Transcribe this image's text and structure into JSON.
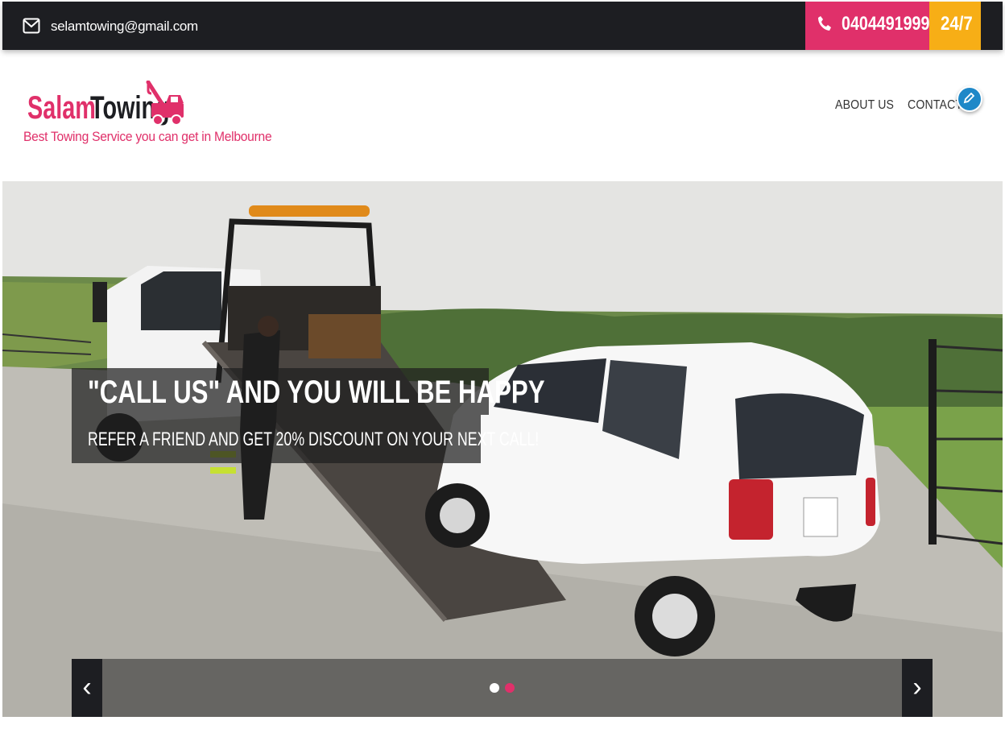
{
  "topbar": {
    "email": "selamtowing@gmail.com",
    "phone": "0404491999",
    "availability": "24/7"
  },
  "brand": {
    "name_part1": "Salam",
    "name_part2": "Towing",
    "tagline": "Best Towing Service you can get in Melbourne"
  },
  "nav": {
    "about": "ABOUT US",
    "contact": "CONTACT"
  },
  "slider": {
    "headline": "\"CALL US\" AND YOU WILL BE HAPPY",
    "subline": "REFER A FRIEND AND GET 20% DISCOUNT ON YOUR NEXT CALL!",
    "prev_label": "‹",
    "next_label": "›",
    "active_slide": 2,
    "slide_count": 2
  },
  "colors": {
    "brand_pink": "#e0306a",
    "accent_orange": "#f7ae16",
    "dark": "#1d1e22",
    "contact_icon_blue": "#1e88c8"
  },
  "icons": [
    "envelope-icon",
    "phone-icon",
    "tow-truck-logo-icon",
    "pencil-icon",
    "chevron-left-icon",
    "chevron-right-icon"
  ]
}
